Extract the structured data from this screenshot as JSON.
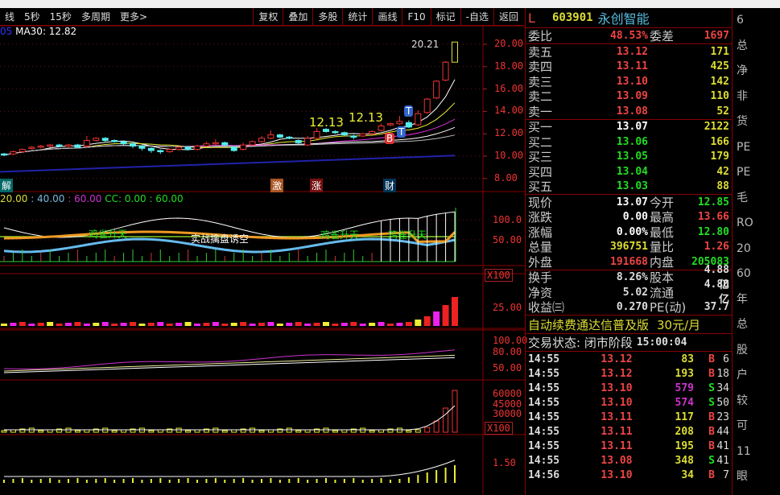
{
  "toolbar": {
    "left": [
      "线",
      "5秒",
      "15秒",
      "多周期",
      "更多>"
    ],
    "buttons": [
      "复权",
      "叠加",
      "多股",
      "统计",
      "画线",
      "F10",
      "标记",
      "-自选",
      "返回"
    ]
  },
  "ma_label": {
    "prefix": "05",
    "text": "MA30: 12.82"
  },
  "price_axis": [
    "20.00",
    "18.00",
    "16.00",
    "14.00",
    "12.00",
    "10.00",
    "8.00"
  ],
  "annotations": {
    "high": "20.21",
    "peak1": "12.13",
    "peak2": "12.13",
    "b": "B",
    "t1": "T",
    "t2": "T"
  },
  "events": [
    "解",
    "激",
    "涨",
    "财"
  ],
  "indicator1": {
    "legend": [
      "20.00",
      ": 40.00",
      ": 60.00",
      "CC: 0.00",
      ": 60.00"
    ],
    "signals": [
      "鸡雀升天",
      "实战擒盘诱空",
      "鸡雀升天",
      "鸡雀升天"
    ],
    "axis": [
      "100.0",
      "50.00"
    ]
  },
  "indicator2": {
    "mult": "X100",
    "axis": [
      "25.00"
    ]
  },
  "indicator3": {
    "axis": [
      "100.00",
      "80.00",
      "50.00"
    ]
  },
  "indicator4": {
    "axis": [
      "60000",
      "45000",
      "30000"
    ],
    "mult": "X100"
  },
  "indicator5": {
    "axis": [
      "1.50"
    ]
  },
  "chart_data": {
    "type": "candlestick",
    "ohlc": [
      [
        10.2,
        10.1,
        10.3,
        10.0
      ],
      [
        10.2,
        10.4,
        10.5,
        10.1
      ],
      [
        10.4,
        10.6,
        10.7,
        10.3
      ],
      [
        10.7,
        10.8,
        10.9,
        10.6
      ],
      [
        10.8,
        10.9,
        11.0,
        10.7
      ],
      [
        10.9,
        11.0,
        11.1,
        10.8
      ],
      [
        11.0,
        10.9,
        11.1,
        10.8
      ],
      [
        10.9,
        11.0,
        11.1,
        10.8
      ],
      [
        11.0,
        10.8,
        11.1,
        10.7
      ],
      [
        10.9,
        11.4,
        11.8,
        10.8
      ],
      [
        11.4,
        11.6,
        11.7,
        11.3
      ],
      [
        11.6,
        11.4,
        11.7,
        11.3
      ],
      [
        11.4,
        11.3,
        11.5,
        11.2
      ],
      [
        11.3,
        11.1,
        11.4,
        11.0
      ],
      [
        11.1,
        10.9,
        11.2,
        10.7
      ],
      [
        10.9,
        10.7,
        11.0,
        10.5
      ],
      [
        10.7,
        10.5,
        10.8,
        10.3
      ],
      [
        10.5,
        10.4,
        10.6,
        10.2
      ],
      [
        10.4,
        10.6,
        10.7,
        10.3
      ],
      [
        10.6,
        10.8,
        10.9,
        10.5
      ],
      [
        10.8,
        10.6,
        10.9,
        10.5
      ],
      [
        10.6,
        10.9,
        11.0,
        10.5
      ],
      [
        10.9,
        11.1,
        11.3,
        10.8
      ],
      [
        11.1,
        11.2,
        11.5,
        11.0
      ],
      [
        11.2,
        11.0,
        11.3,
        10.9
      ],
      [
        10.8,
        10.5,
        10.9,
        10.4
      ],
      [
        10.6,
        11.0,
        11.2,
        10.5
      ],
      [
        11.0,
        11.3,
        11.4,
        10.9
      ],
      [
        11.3,
        11.6,
        11.8,
        11.2
      ],
      [
        11.6,
        11.9,
        12.3,
        11.5
      ],
      [
        11.9,
        11.7,
        12.0,
        11.6
      ],
      [
        11.7,
        11.6,
        11.8,
        11.5
      ],
      [
        11.4,
        11.2,
        11.5,
        11.1
      ],
      [
        11.0,
        11.6,
        11.8,
        10.9
      ],
      [
        11.6,
        12.2,
        12.5,
        11.5
      ],
      [
        12.4,
        12.2,
        12.5,
        12.1
      ],
      [
        12.2,
        12.1,
        12.3,
        12.0
      ],
      [
        12.1,
        11.9,
        12.2,
        11.8
      ],
      [
        11.8,
        11.7,
        11.9,
        11.5
      ],
      [
        11.8,
        12.0,
        12.1,
        11.7
      ],
      [
        12.0,
        12.2,
        12.3,
        11.9
      ],
      [
        12.3,
        12.7,
        12.9,
        12.2
      ],
      [
        12.8,
        12.9,
        13.0,
        12.7
      ],
      [
        12.9,
        13.1,
        13.6,
        12.8
      ],
      [
        13.0,
        12.6,
        13.2,
        12.5
      ],
      [
        12.8,
        13.8,
        14.1,
        12.7
      ],
      [
        13.9,
        15.1,
        15.2,
        13.8
      ],
      [
        15.2,
        16.7,
        16.8,
        15.1
      ],
      [
        16.8,
        18.4,
        18.5,
        16.7
      ],
      [
        18.4,
        20.2,
        20.21,
        18.4
      ]
    ],
    "ylim": [
      7,
      21
    ]
  },
  "quote": {
    "flag": "L",
    "code": "603901",
    "name": "永创智能",
    "weibi": {
      "label": "委比",
      "value": "48.53%",
      "label2": "委差",
      "value2": "1697"
    },
    "asks": [
      {
        "label": "卖五",
        "price": "13.12",
        "vol": "171"
      },
      {
        "label": "卖四",
        "price": "13.11",
        "vol": "425"
      },
      {
        "label": "卖三",
        "price": "13.10",
        "vol": "142"
      },
      {
        "label": "卖二",
        "price": "13.09",
        "vol": "110"
      },
      {
        "label": "卖一",
        "price": "13.08",
        "vol": "52"
      }
    ],
    "bids": [
      {
        "label": "买一",
        "price": "13.07",
        "vol": "2122"
      },
      {
        "label": "买二",
        "price": "13.06",
        "vol": "166"
      },
      {
        "label": "买三",
        "price": "13.05",
        "vol": "179"
      },
      {
        "label": "买四",
        "price": "13.04",
        "vol": "42"
      },
      {
        "label": "买五",
        "price": "13.03",
        "vol": "88"
      }
    ],
    "stats": [
      {
        "l1": "现价",
        "v1": "13.07",
        "l2": "今开",
        "v2": "12.85"
      },
      {
        "l1": "涨跌",
        "v1": "0.00",
        "l2": "最高",
        "v2": "13.66"
      },
      {
        "l1": "涨幅",
        "v1": "0.00%",
        "l2": "最低",
        "v2": "12.80"
      },
      {
        "l1": "总量",
        "v1": "396751",
        "l2": "量比",
        "v2": "1.26"
      },
      {
        "l1": "外盘",
        "v1": "191668",
        "l2": "内盘",
        "v2": "205083"
      }
    ],
    "fund": [
      {
        "l1": "换手",
        "v1": "8.26%",
        "l2": "股本",
        "v2": "4.88亿"
      },
      {
        "l1": "净资",
        "v1": "5.02",
        "l2": "流通",
        "v2": "4.80亿"
      },
      {
        "l1": "收益㈢",
        "v1": "0.270",
        "l2": "PE(动)",
        "v2": "37.7"
      }
    ],
    "promo": "自动续费通达信普及版",
    "promo_price": "30元/月",
    "status_label": "交易状态: 闭市阶段",
    "status_time": "15:00:04"
  },
  "ticks": [
    [
      "14:55",
      "13.12",
      "83",
      "B",
      "6"
    ],
    [
      "14:55",
      "13.12",
      "193",
      "B",
      "18"
    ],
    [
      "14:55",
      "13.10",
      "579",
      "S",
      "34"
    ],
    [
      "14:55",
      "13.10",
      "574",
      "S",
      "50"
    ],
    [
      "14:55",
      "13.11",
      "117",
      "B",
      "23"
    ],
    [
      "14:55",
      "13.11",
      "208",
      "B",
      "44"
    ],
    [
      "14:55",
      "13.11",
      "195",
      "B",
      "41"
    ],
    [
      "14:55",
      "13.08",
      "348",
      "S",
      "41"
    ],
    [
      "14:56",
      "13.10",
      "34",
      "B",
      "7"
    ]
  ],
  "side": [
    "6",
    "总",
    "净",
    "非",
    "货",
    "PE",
    "PE",
    "毛",
    "RO",
    "20",
    "60",
    "年",
    "总",
    "股",
    "户",
    "较",
    "可",
    "11",
    "眼"
  ]
}
